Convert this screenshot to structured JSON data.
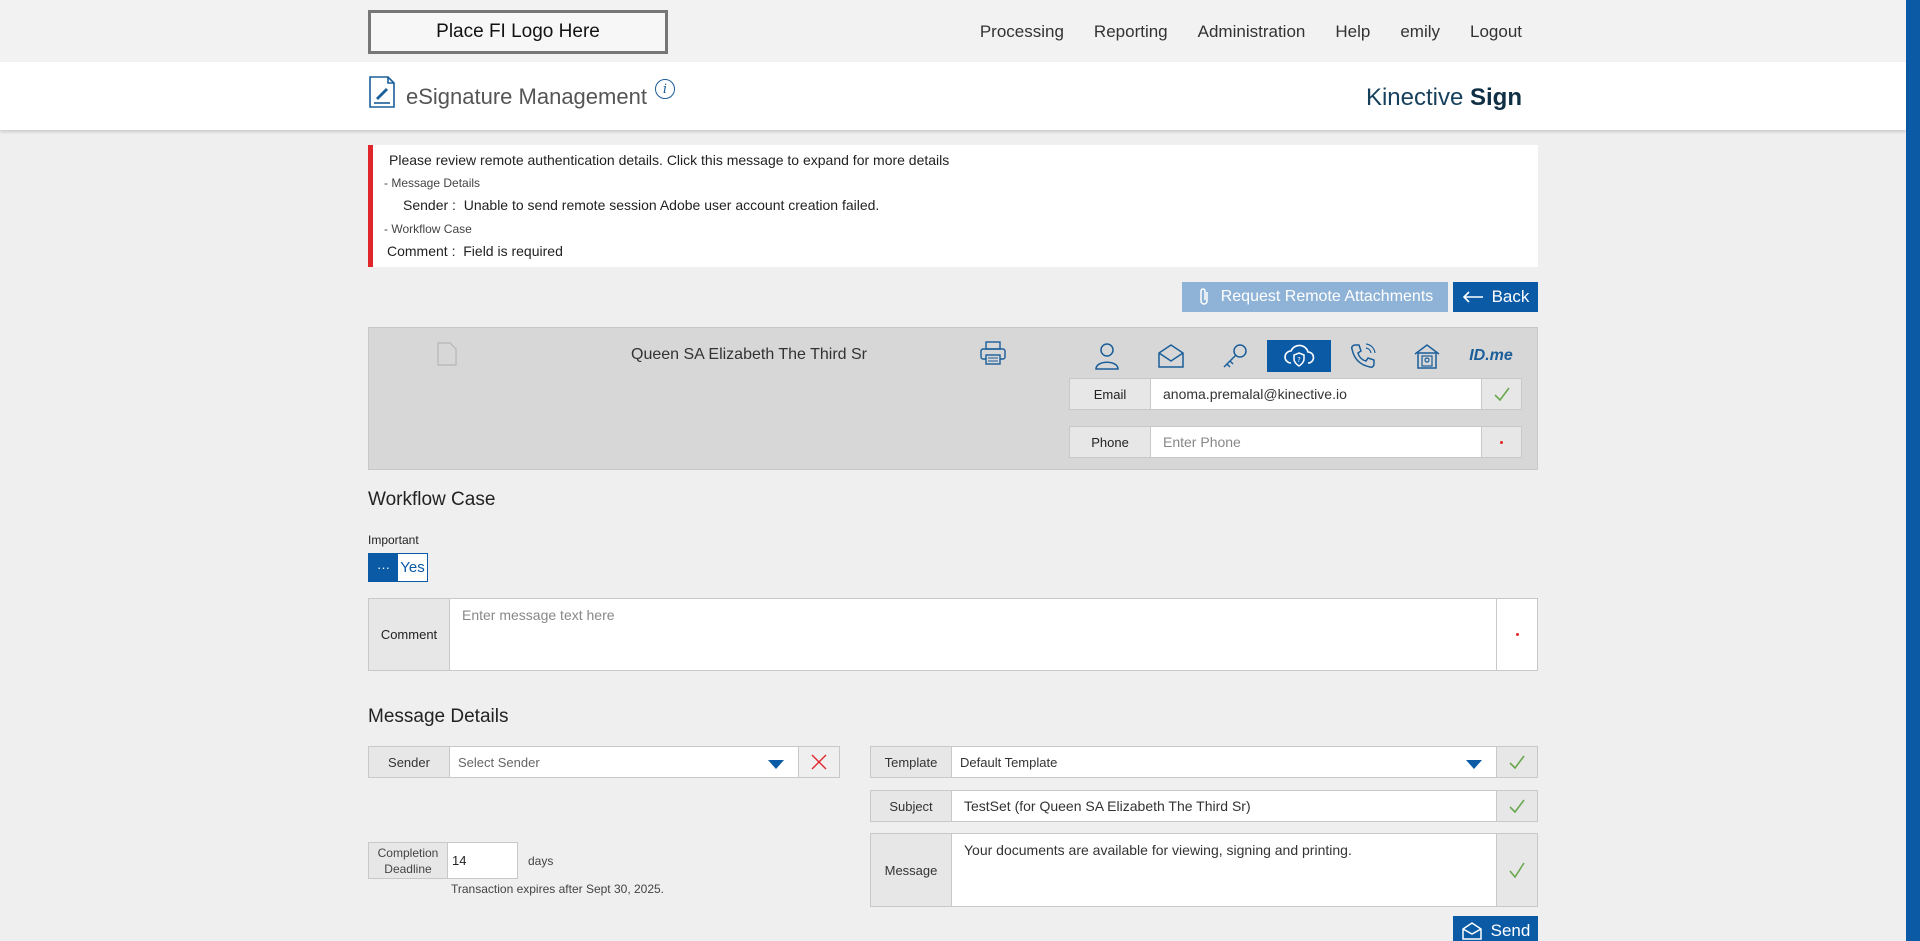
{
  "topbar": {
    "logo_text": "Place FI Logo Here",
    "nav": [
      "Processing",
      "Reporting",
      "Administration",
      "Help",
      "emily",
      "Logout"
    ]
  },
  "header": {
    "title": "eSignature Management",
    "brand_light": "Kinective ",
    "brand_bold": "Sign"
  },
  "alert": {
    "main": "Please review remote authentication details. Click this message to expand for more details",
    "section1": "- Message Details",
    "row1_label": "Sender :",
    "row1_text": "Unable to send remote session Adobe user account creation failed.",
    "section2": "- Workflow Case",
    "row2_label": "Comment :",
    "row2_text": "Field is required"
  },
  "actions": {
    "request_attachments": "Request Remote Attachments",
    "back": "Back"
  },
  "recipient": {
    "name": "Queen SA Elizabeth The Third Sr",
    "auth_methods": [
      "user-icon",
      "envelope-icon",
      "key-icon",
      "cloud-shield-icon",
      "phone-icon",
      "house-user-icon",
      "idme-logo"
    ],
    "idme_text": "ID.me",
    "email_label": "Email",
    "email_value": "anoma.premalal@kinective.io",
    "phone_label": "Phone",
    "phone_placeholder": "Enter Phone"
  },
  "workflow": {
    "heading": "Workflow Case",
    "important_label": "Important",
    "toggle_knob": "···",
    "toggle_value": "Yes",
    "comment_label": "Comment",
    "comment_placeholder": "Enter message text here"
  },
  "message": {
    "heading": "Message Details",
    "sender_label": "Sender",
    "sender_placeholder": "Select Sender",
    "deadline_label_line1": "Completion",
    "deadline_label_line2": "Deadline",
    "deadline_value": "14",
    "days": "days",
    "expires": "Transaction expires after Sept 30, 2025.",
    "template_label": "Template",
    "template_value": "Default Template",
    "subject_label": "Subject",
    "subject_value": "TestSet (for Queen SA Elizabeth The Third Sr)",
    "message_label": "Message",
    "message_value": "Your documents are available for viewing, signing and printing.",
    "send": "Send"
  },
  "colors": {
    "primary": "#0a5aa6",
    "disabled_button": "#8eb3d6",
    "error": "#e0262a",
    "check": "#6aa84f"
  }
}
